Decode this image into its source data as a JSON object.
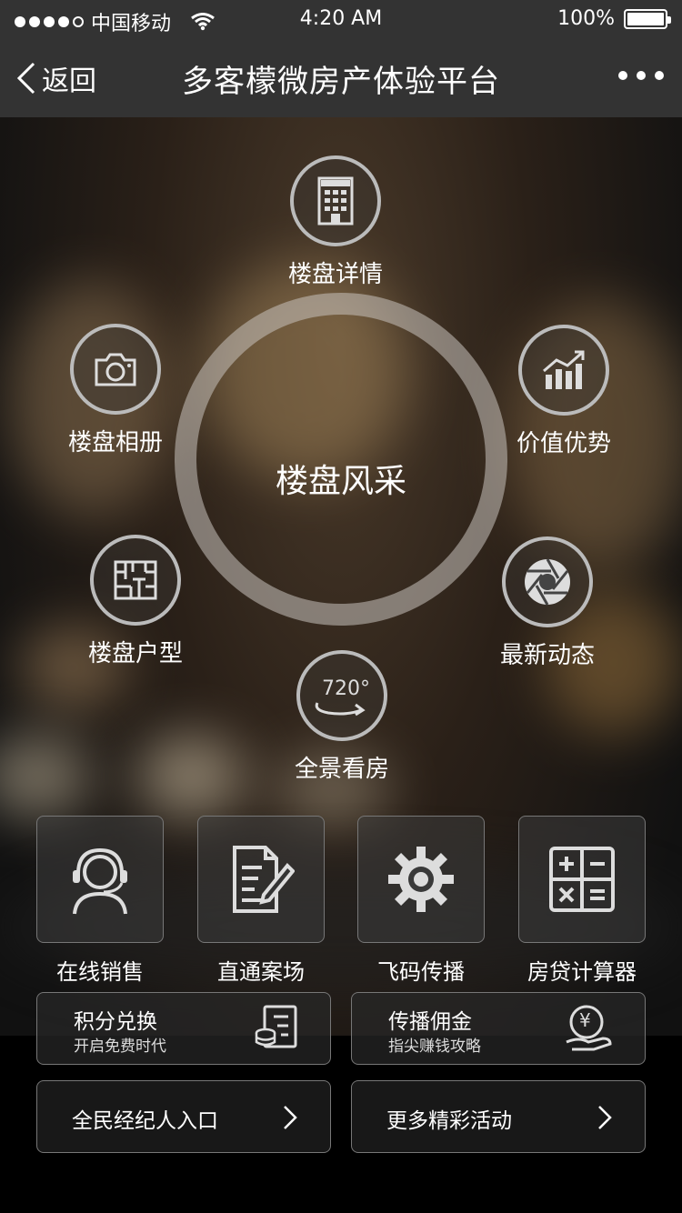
{
  "status_bar": {
    "carrier": "中国移动",
    "time": "4:20 AM",
    "battery": "100%"
  },
  "nav": {
    "back_label": "返回",
    "title": "多客檬微房产体验平台"
  },
  "ring": {
    "center_label": "楼盘风采"
  },
  "orbit_items": [
    {
      "label": "楼盘详情",
      "icon": "building-icon"
    },
    {
      "label": "楼盘相册",
      "icon": "camera-icon"
    },
    {
      "label": "价值优势",
      "icon": "chart-icon"
    },
    {
      "label": "楼盘户型",
      "icon": "floorplan-icon"
    },
    {
      "label": "最新动态",
      "icon": "aperture-icon"
    },
    {
      "label": "全景看房",
      "icon": "panorama-720-icon",
      "icon_text": "720°"
    }
  ],
  "tiles": [
    {
      "label": "在线销售",
      "icon": "headset-agent-icon"
    },
    {
      "label": "直通案场",
      "icon": "document-edit-icon"
    },
    {
      "label": "飞码传播",
      "icon": "gear-icon"
    },
    {
      "label": "房贷计算器",
      "icon": "calculator-icon"
    }
  ],
  "cards": [
    {
      "title": "积分兑换",
      "subtitle": "开启免费时代",
      "icon": "coins-list-icon"
    },
    {
      "title": "传播佣金",
      "subtitle": "指尖赚钱攻略",
      "icon": "yen-hand-icon",
      "icon_text": "¥"
    }
  ],
  "entries": [
    {
      "label": "全民经纪人入口"
    },
    {
      "label": "更多精彩活动"
    }
  ]
}
